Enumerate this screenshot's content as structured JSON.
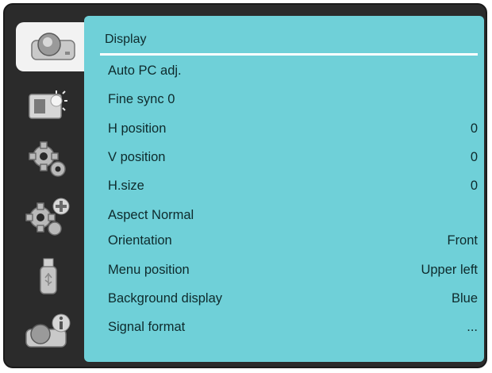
{
  "sidebar": {
    "items": [
      {
        "icon": "display-icon",
        "active": true
      },
      {
        "icon": "image-adjust-icon",
        "active": false
      },
      {
        "icon": "gear-icon",
        "active": false
      },
      {
        "icon": "advanced-gear-icon",
        "active": false
      },
      {
        "icon": "usb-icon",
        "active": false
      },
      {
        "icon": "info-icon",
        "active": false
      }
    ]
  },
  "panel": {
    "title": "Display",
    "items": [
      {
        "label": "Auto PC adj.",
        "value": ""
      },
      {
        "label": "Fine sync 0",
        "value": ""
      },
      {
        "label": "H position",
        "value": "0"
      },
      {
        "label": "V position",
        "value": "0"
      },
      {
        "label": "H.size",
        "value": "0"
      },
      {
        "label": "Aspect Normal",
        "value": ""
      },
      {
        "label": "Orientation",
        "value": "Front"
      },
      {
        "label": "Menu position",
        "value": "Upper left"
      },
      {
        "label": "Background display",
        "value": "Blue"
      },
      {
        "label": "Signal format",
        "value": "..."
      }
    ]
  },
  "colors": {
    "panel_bg": "#6fd0d8",
    "frame_bg": "#2b2b2b",
    "active_tab": "#f2f2f2",
    "text": "#0e2a2c"
  }
}
